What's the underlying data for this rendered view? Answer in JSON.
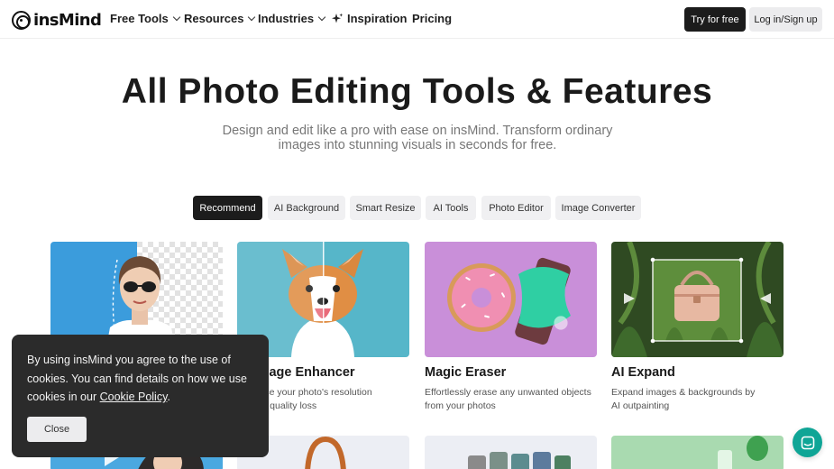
{
  "brand": {
    "name": "insMind"
  },
  "nav": {
    "items": [
      {
        "label": "Free Tools",
        "dropdown": true
      },
      {
        "label": "Resources",
        "dropdown": true
      },
      {
        "label": "Industries",
        "dropdown": true
      },
      {
        "label": "Inspiration",
        "icon": "sparkle-icon"
      },
      {
        "label": "Pricing"
      }
    ],
    "try_label": "Try for free",
    "login_label": "Log in/Sign up"
  },
  "hero": {
    "title": "All Photo Editing Tools & Features",
    "subtitle": "Design and edit like a pro with ease on insMind. Transform ordinary images into stunning visuals in seconds for free."
  },
  "tabs": [
    {
      "label": "Recommend",
      "active": true
    },
    {
      "label": "AI Background",
      "active": false
    },
    {
      "label": "Smart Resize",
      "active": false
    },
    {
      "label": "AI Tools",
      "active": false
    },
    {
      "label": "Photo Editor",
      "active": false
    },
    {
      "label": "Image Converter",
      "active": false
    }
  ],
  "cards": [
    {
      "title": "",
      "desc": ""
    },
    {
      "title": "AI Image Enhancer",
      "desc": "Enhance your photo's resolution without quality loss"
    },
    {
      "title": "Magic Eraser",
      "desc": "Effortlessly erase any unwanted objects from your photos"
    },
    {
      "title": "AI Expand",
      "desc": "Expand images & backgrounds by AI outpainting"
    }
  ],
  "cookie": {
    "text_1": "By using insMind you agree to the use of cookies. You can find details on how we use cookies in our ",
    "link_label": "Cookie Policy",
    "text_2": ".",
    "close_label": "Close"
  },
  "colors": {
    "accent_dark": "#1c1c1c",
    "chat_button": "#0fa596",
    "cookie_bg": "#2b2b2b"
  }
}
